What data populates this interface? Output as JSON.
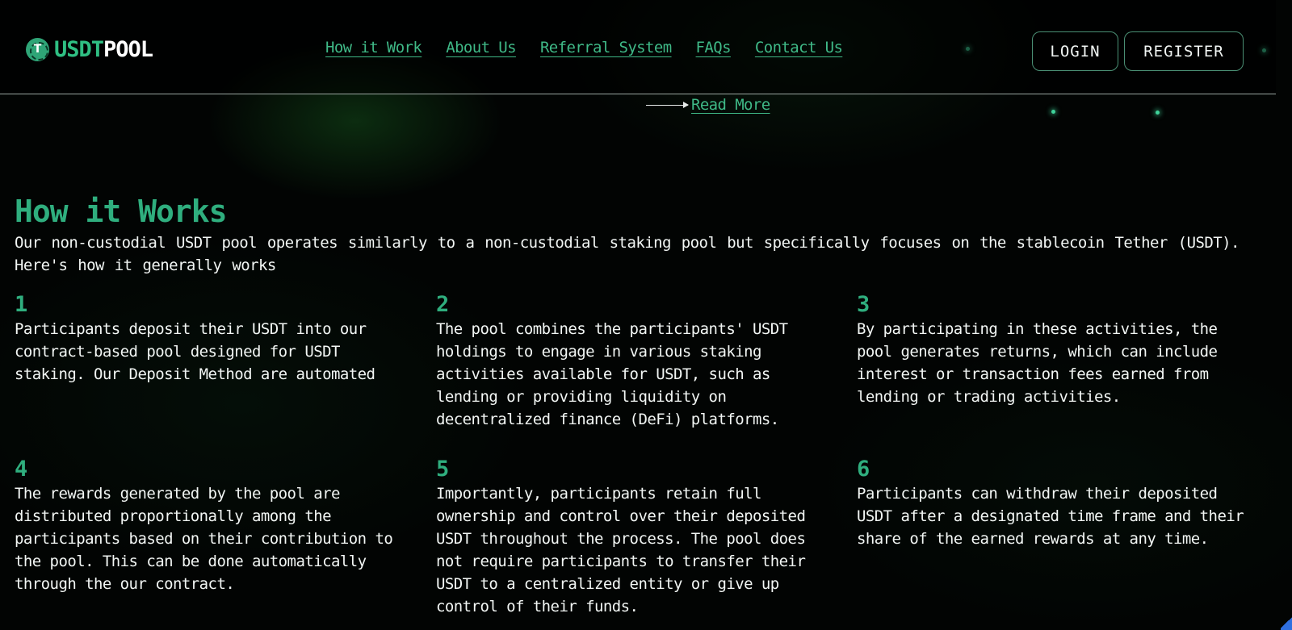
{
  "brand": {
    "logo_part1": "USDT",
    "logo_part2": "POOL",
    "logo_icon": "tether-coin-icon",
    "accent_color": "#2fae7e"
  },
  "nav": {
    "items": [
      {
        "label": "How it Work"
      },
      {
        "label": "About Us"
      },
      {
        "label": "Referral System"
      },
      {
        "label": "FAQs"
      },
      {
        "label": "Contact Us"
      }
    ]
  },
  "auth": {
    "login_label": "LOGIN",
    "register_label": "REGISTER"
  },
  "hero": {
    "read_more": "Read More"
  },
  "how_it_works": {
    "title": "How it Works",
    "intro": "Our non-custodial USDT pool operates similarly to a non-custodial staking pool but specifically focuses on the stablecoin Tether (USDT). Here's how it generally works",
    "steps": [
      {
        "num": "1",
        "text": "Participants deposit their USDT into our contract-based pool designed for USDT staking. Our Deposit Method are automated"
      },
      {
        "num": "2",
        "text": "The pool combines the participants' USDT holdings to engage in various staking activities available for USDT, such as lending or providing liquidity on decentralized finance (DeFi) platforms."
      },
      {
        "num": "3",
        "text": "By participating in these activities, the pool generates returns, which can include interest or transaction fees earned from lending or trading activities."
      },
      {
        "num": "4",
        "text": "The rewards generated by the pool are distributed proportionally among the participants based on their contribution to the pool. This can be done automatically through the our contract."
      },
      {
        "num": "5",
        "text": "Importantly, participants retain full ownership and control over their deposited USDT throughout the process. The pool does not require participants to transfer their USDT to a centralized entity or give up control of their funds."
      },
      {
        "num": "6",
        "text": "Participants can withdraw their deposited USDT after a designated time frame and their share of the earned rewards at any time."
      }
    ]
  }
}
